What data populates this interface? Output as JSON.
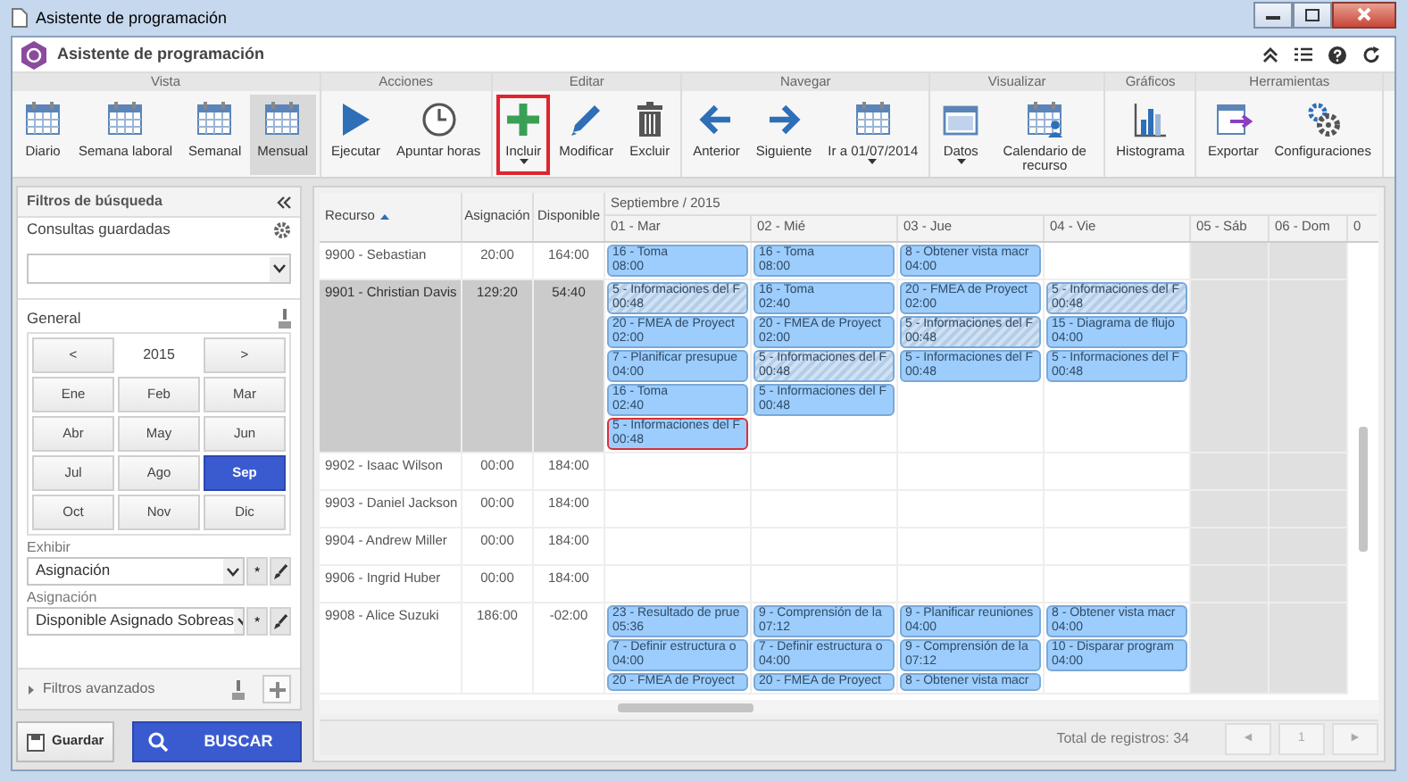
{
  "window": {
    "title": "Asistente de programación"
  },
  "app": {
    "title": "Asistente de programación"
  },
  "ribbon": [
    {
      "label": "Vista",
      "buttons": [
        {
          "label": "Diario",
          "selected": false
        },
        {
          "label": "Semana laboral",
          "selected": false
        },
        {
          "label": "Semanal",
          "selected": false
        },
        {
          "label": "Mensual",
          "selected": true
        }
      ]
    },
    {
      "label": "Acciones",
      "buttons": [
        {
          "label": "Ejecutar",
          "selected": false
        },
        {
          "label": "Apuntar horas",
          "selected": false
        }
      ]
    },
    {
      "label": "Editar",
      "buttons": [
        {
          "label": "Incluir",
          "selected": false,
          "highlighted": true,
          "dropdown": true
        },
        {
          "label": "Modificar",
          "selected": false
        },
        {
          "label": "Excluir",
          "selected": false
        }
      ]
    },
    {
      "label": "Navegar",
      "buttons": [
        {
          "label": "Anterior",
          "selected": false
        },
        {
          "label": "Siguiente",
          "selected": false
        },
        {
          "label": "Ir a 01/07/2014",
          "selected": false,
          "dropdown": true
        }
      ]
    },
    {
      "label": "Visualizar",
      "buttons": [
        {
          "label": "Datos",
          "selected": false,
          "dropdown": true
        },
        {
          "label": "Calendario de recurso",
          "selected": false
        }
      ]
    },
    {
      "label": "Gráficos",
      "buttons": [
        {
          "label": "Histograma",
          "selected": false
        }
      ]
    },
    {
      "label": "Herramientas",
      "buttons": [
        {
          "label": "Exportar",
          "selected": false
        },
        {
          "label": "Configuraciones",
          "selected": false
        }
      ]
    }
  ],
  "filters": {
    "title": "Filtros de búsqueda",
    "saved_queries": {
      "label": "Consultas guardadas"
    },
    "general": {
      "label": "General",
      "prev": "<",
      "year": "2015",
      "next": ">",
      "months": [
        {
          "label": "Ene",
          "selected": false
        },
        {
          "label": "Feb",
          "selected": false
        },
        {
          "label": "Mar",
          "selected": false
        },
        {
          "label": "Abr",
          "selected": false
        },
        {
          "label": "May",
          "selected": false
        },
        {
          "label": "Jun",
          "selected": false
        },
        {
          "label": "Jul",
          "selected": false
        },
        {
          "label": "Ago",
          "selected": false
        },
        {
          "label": "Sep",
          "selected": true
        },
        {
          "label": "Oct",
          "selected": false
        },
        {
          "label": "Nov",
          "selected": false
        },
        {
          "label": "Dic",
          "selected": false
        }
      ]
    },
    "display": {
      "label": "Exhibir",
      "value": "Asignación",
      "asterisk": "*"
    },
    "assignment": {
      "label": "Asignación",
      "value": "Disponible Asignado Sobreas",
      "asterisk": "*"
    },
    "advanced": {
      "label": "Filtros avanzados",
      "expanded": false
    },
    "save_button": "Guardar",
    "search_button": "BUSCAR"
  },
  "grid": {
    "columns": [
      {
        "label": "Recurso",
        "sorted": true
      },
      {
        "label": "Asignación",
        "sorted": false
      },
      {
        "label": "Disponible",
        "sorted": false
      }
    ],
    "month": "Septiembre / 2015",
    "days": [
      {
        "label": "01 - Mar",
        "weekend": false
      },
      {
        "label": "02 - Mié",
        "weekend": false
      },
      {
        "label": "03 - Jue",
        "weekend": false
      },
      {
        "label": "04 - Vie",
        "weekend": false
      },
      {
        "label": "05 - Sáb",
        "weekend": true
      },
      {
        "label": "06 - Dom",
        "weekend": true
      }
    ],
    "column_10": "0",
    "rows": [
      {
        "resource": "9900 - Sebastian",
        "assigned": "20:00",
        "available": "164:00",
        "selected": false,
        "day_1": [
          {
            "title": "16 - Toma",
            "time": "08:00",
            "hatched": false,
            "selected": false
          }
        ],
        "day_2": [
          {
            "title": "16 - Toma",
            "time": "08:00",
            "hatched": false,
            "selected": false
          }
        ],
        "day_3": [
          {
            "title": "8 - Obtener vista macr",
            "time": "04:00",
            "hatched": false,
            "selected": false
          }
        ]
      },
      {
        "resource": "9901 - Christian Davis",
        "assigned": "129:20",
        "available": "54:40",
        "selected": true,
        "day_1": [
          {
            "title": "5 - Informaciones del F",
            "time": "00:48",
            "hatched": true,
            "selected": false
          },
          {
            "title": "20 - FMEA de Proyect",
            "time": "02:00",
            "hatched": false,
            "selected": false
          },
          {
            "title": "7 - Planificar presupue",
            "time": "04:00",
            "hatched": false,
            "selected": false
          },
          {
            "title": "16 - Toma",
            "time": "02:40",
            "hatched": false,
            "selected": false
          },
          {
            "title": "5 - Informaciones del F",
            "time": "00:48",
            "hatched": false,
            "selected": true
          }
        ],
        "day_2": [
          {
            "title": "16 - Toma",
            "time": "02:40",
            "hatched": false,
            "selected": false
          },
          {
            "title": "20 - FMEA de Proyect",
            "time": "02:00",
            "hatched": false,
            "selected": false
          },
          {
            "title": "5 - Informaciones del F",
            "time": "00:48",
            "hatched": true,
            "selected": false
          },
          {
            "title": "5 - Informaciones del F",
            "time": "00:48",
            "hatched": false,
            "selected": false
          }
        ],
        "day_3": [
          {
            "title": "20 - FMEA de Proyect",
            "time": "02:00",
            "hatched": false,
            "selected": false
          },
          {
            "title": "5 - Informaciones del F",
            "time": "00:48",
            "hatched": true,
            "selected": false
          },
          {
            "title": "5 - Informaciones del F",
            "time": "00:48",
            "hatched": false,
            "selected": false
          }
        ],
        "day_4": [
          {
            "title": "5 - Informaciones del F",
            "time": "00:48",
            "hatched": true,
            "selected": false
          },
          {
            "title": "15 - Diagrama de flujo",
            "time": "04:00",
            "hatched": false,
            "selected": false
          },
          {
            "title": "5 - Informaciones del F",
            "time": "00:48",
            "hatched": false,
            "selected": false
          }
        ]
      },
      {
        "resource": "9902 - Isaac Wilson",
        "assigned": "00:00",
        "available": "184:00",
        "selected": false
      },
      {
        "resource": "9903 - Daniel Jackson",
        "assigned": "00:00",
        "available": "184:00",
        "selected": false
      },
      {
        "resource": "9904 - Andrew Miller",
        "assigned": "00:00",
        "available": "184:00",
        "selected": false
      },
      {
        "resource": "9906 - Ingrid Huber",
        "assigned": "00:00",
        "available": "184:00",
        "selected": false
      },
      {
        "resource": "9908 - Alice Suzuki",
        "assigned": "186:00",
        "available": "-02:00",
        "selected": false,
        "day_1": [
          {
            "title": "23 - Resultado de prue",
            "time": "05:36",
            "hatched": false,
            "selected": false
          },
          {
            "title": "7 - Definir estructura o",
            "time": "04:00",
            "hatched": false,
            "selected": false
          },
          {
            "title": "20 - FMEA de Proyect",
            "hatched": false,
            "selected": false
          }
        ],
        "day_2": [
          {
            "title": "9 - Comprensión de la",
            "time": "07:12",
            "hatched": false,
            "selected": false
          },
          {
            "title": "7 - Definir estructura o",
            "time": "04:00",
            "hatched": false,
            "selected": false
          },
          {
            "title": "20 - FMEA de Proyect",
            "hatched": false,
            "selected": false
          }
        ],
        "day_3": [
          {
            "title": "9 - Planificar reuniones",
            "time": "04:00",
            "hatched": false,
            "selected": false
          },
          {
            "title": "9 - Comprensión de la",
            "time": "07:12",
            "hatched": false,
            "selected": false
          },
          {
            "title": "8 - Obtener vista macr",
            "hatched": false,
            "selected": false
          }
        ],
        "day_4": [
          {
            "title": "8 - Obtener vista macr",
            "time": "04:00",
            "hatched": false,
            "selected": false
          },
          {
            "title": "10 - Disparar program",
            "time": "04:00",
            "hatched": false,
            "selected": false
          }
        ]
      }
    ]
  },
  "footer": {
    "total": "Total de registros: 34",
    "prev": "◄",
    "page": "1",
    "next": "►"
  }
}
